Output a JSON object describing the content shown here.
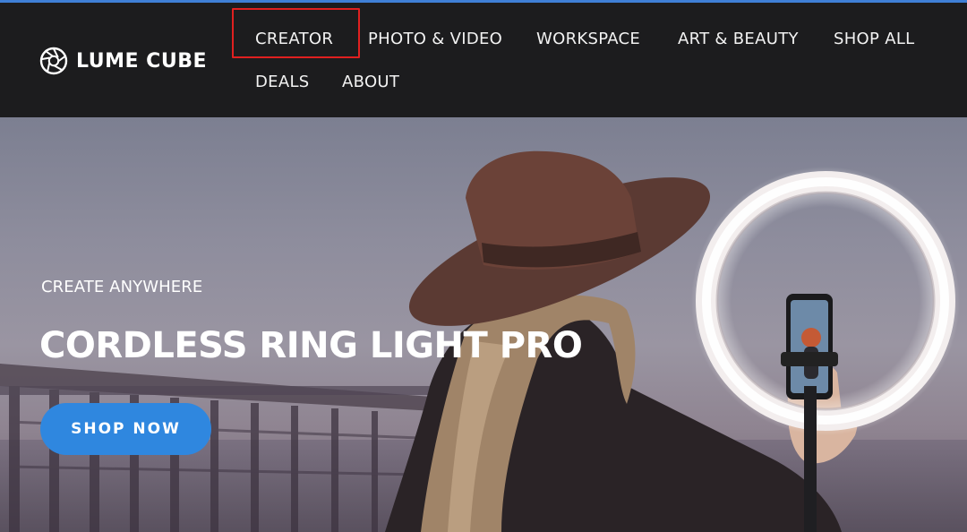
{
  "brand": {
    "name": "LUME CUBE",
    "logo_icon": "aperture-icon"
  },
  "nav": {
    "items": [
      {
        "label": "CREATOR",
        "highlighted": true
      },
      {
        "label": "PHOTO & VIDEO"
      },
      {
        "label": "WORKSPACE"
      },
      {
        "label": "ART & BEAUTY"
      },
      {
        "label": "SHOP ALL"
      },
      {
        "label": "DEALS"
      },
      {
        "label": "ABOUT"
      }
    ]
  },
  "hero": {
    "eyebrow": "CREATE ANYWHERE",
    "title": "CORDLESS RING LIGHT PRO",
    "cta_label": "SHOP NOW"
  },
  "colors": {
    "accent": "#2f87df",
    "nav_background": "#1c1c1e",
    "highlight": "#e02020",
    "top_strip": "#3f7fd6"
  }
}
